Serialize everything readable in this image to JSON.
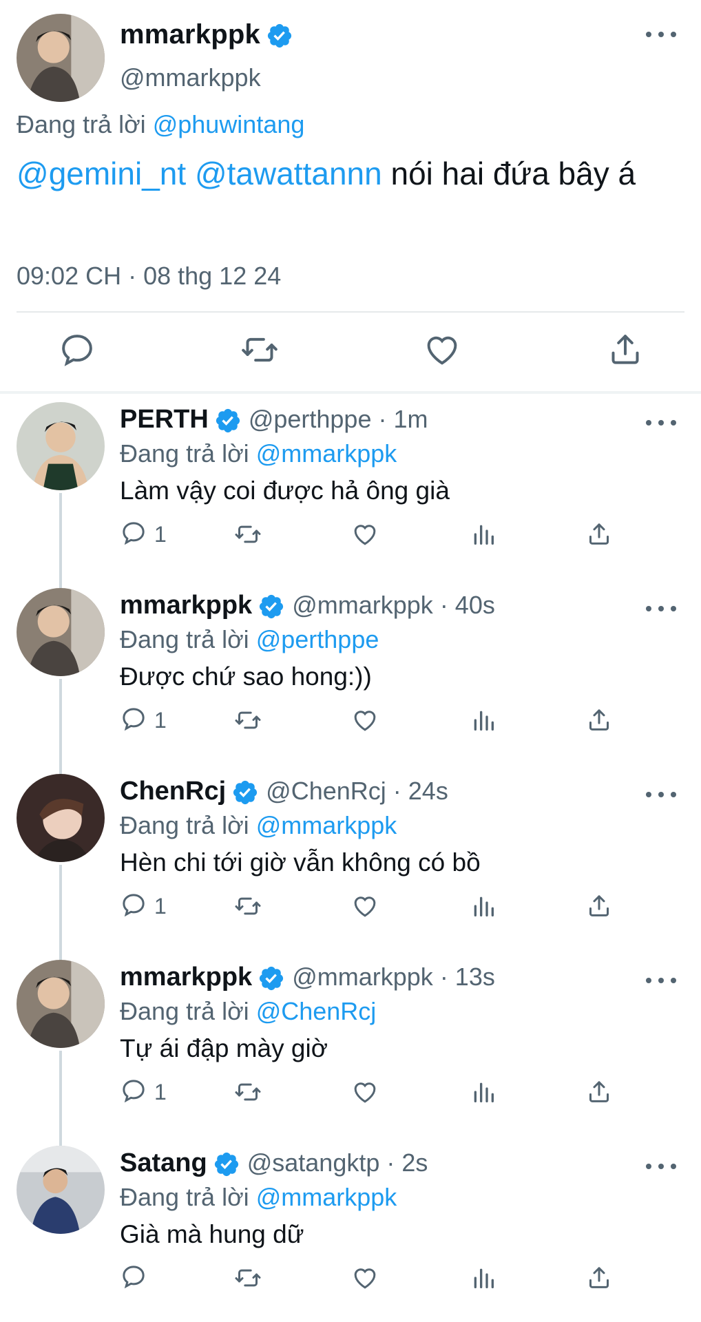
{
  "main_tweet": {
    "name": "mmarkppk",
    "handle": "@mmarkppk",
    "replying_label": "Đang trả lời",
    "replying_to": "@phuwintang",
    "mentions": [
      "@gemini_nt",
      "@tawattannn"
    ],
    "text": "nói hai đứa bây á",
    "timestamp": "09:02 CH · 08 thg 12 24",
    "actions": [
      "reply-icon",
      "retweet-icon",
      "like-icon",
      "share-icon"
    ]
  },
  "replies": [
    {
      "name": "PERTH",
      "handle": "@perthppe",
      "time": "· 1m",
      "replying_label": "Đang trả lời",
      "replying_to": "@mmarkppk",
      "text": "Làm vậy coi được hả ông già",
      "reply_count": "1"
    },
    {
      "name": "mmarkppk",
      "handle": "@mmarkppk",
      "time": "· 40s",
      "replying_label": "Đang trả lời",
      "replying_to": "@perthppe",
      "text": "Được chứ sao hong:))",
      "reply_count": "1"
    },
    {
      "name": "ChenRcj",
      "handle": "@ChenRcj",
      "time": "· 24s",
      "replying_label": "Đang trả lời",
      "replying_to": "@mmarkppk",
      "text": "Hèn chi tới giờ vẫn không có bồ",
      "reply_count": "1"
    },
    {
      "name": "mmarkppk",
      "handle": "@mmarkppk",
      "time": "· 13s",
      "replying_label": "Đang trả lời",
      "replying_to": "@ChenRcj",
      "text": "Tự ái đập mày giờ",
      "reply_count": "1"
    },
    {
      "name": "Satang",
      "handle": "@satangktp",
      "time": "· 2s",
      "replying_label": "Đang trả lời",
      "replying_to": "@mmarkppk",
      "text": "Già mà hung dữ",
      "reply_count": ""
    }
  ],
  "colors": {
    "accent": "#1d9bf0",
    "secondary_text": "#536471",
    "text": "#0f1419",
    "verified": "#1d9bf0"
  }
}
